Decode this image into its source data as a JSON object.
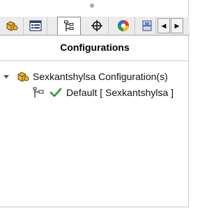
{
  "panel": {
    "title": "Configurations",
    "tabs": [
      {
        "name": "part-icon"
      },
      {
        "name": "property-manager-icon"
      },
      {
        "name": "configuration-manager-icon",
        "active": true
      },
      {
        "name": "dimxpert-icon"
      },
      {
        "name": "display-manager-icon"
      },
      {
        "name": "appearance-icon"
      }
    ],
    "scroll_left": "◀",
    "scroll_right": "▶"
  },
  "tree": {
    "root_label": "Sexkantshylsa Configuration(s)",
    "child_label": "Default [ Sexkantshylsa ]"
  },
  "colors": {
    "check_green": "#2e9a2e",
    "part_yellow": "#f2b233"
  }
}
